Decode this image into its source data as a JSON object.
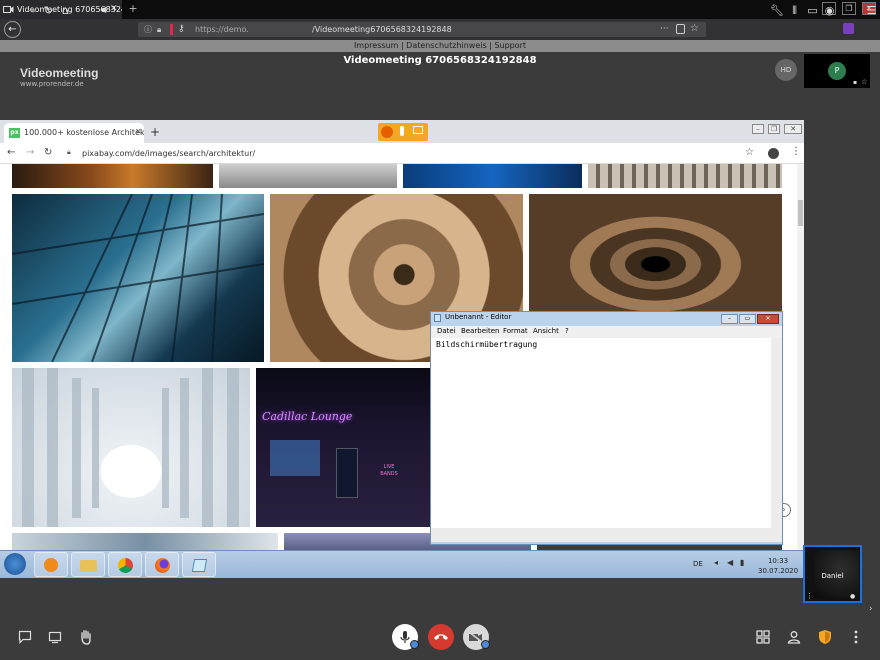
{
  "firefox": {
    "tab_title": "Videomeeting 670656832419",
    "url_prefix": "https://demo.",
    "url_path": "/Videomeeting6706568324192848"
  },
  "meeting": {
    "imprint_links": "Impressum | Datenschutzhinweis | Support",
    "title": "Videomeeting 6706568324192848",
    "logo_title": "Videomeeting",
    "logo_sub": "www.prorender.de",
    "avatar_initials": "HD",
    "self_initial": "P",
    "participant_name": "Daniel"
  },
  "shared_screen": {
    "chrome_tab_title": "100.000+ kostenlose Architektur",
    "px_logo": "px",
    "omnibox_url": "pixabay.com/de/images/search/architektur/",
    "image_captions": {
      "neon_sign": "Cadillac Lounge",
      "live_bands": "LIVE BANDS"
    },
    "notepad": {
      "title": "Unbenannt - Editor",
      "menu": [
        "Datei",
        "Bearbeiten",
        "Format",
        "Ansicht",
        "?"
      ],
      "content": "Bildschirmübertragung"
    },
    "taskbar": {
      "lang": "DE",
      "time": "10:33",
      "date": "30.07.2020"
    }
  }
}
